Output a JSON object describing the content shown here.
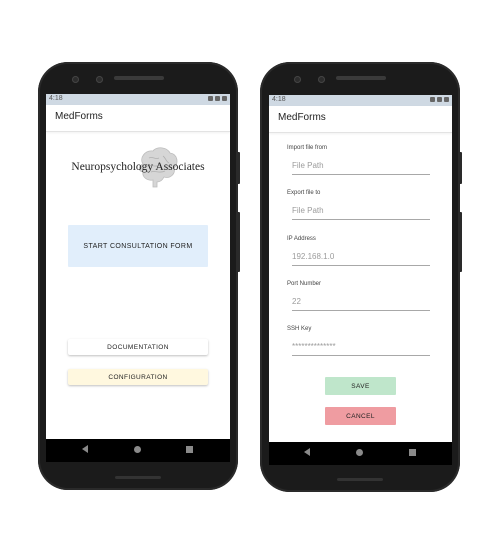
{
  "left_phone": {
    "status_time": "4:18",
    "app_title": "MedForms",
    "logo_text": "Neuropsychology Associates",
    "start_button": "START CONSULTATION FORM",
    "documentation_button": "DOCUMENTATION",
    "configuration_button": "CONFIGURATION"
  },
  "right_phone": {
    "status_time": "4:18",
    "app_title": "MedForms",
    "fields": [
      {
        "label": "Import file from",
        "placeholder": "File Path"
      },
      {
        "label": "Export file to",
        "placeholder": "File Path"
      },
      {
        "label": "IP Address",
        "placeholder": "192.168.1.0"
      },
      {
        "label": "Port Number",
        "placeholder": "22"
      },
      {
        "label": "SSH Key",
        "placeholder": "**************"
      }
    ],
    "save_button": "SAVE",
    "cancel_button": "CANCEL"
  },
  "colors": {
    "start_button_bg": "#e1eefb",
    "configuration_button_bg": "#fff8df",
    "save_button_bg": "#bfe6cb",
    "cancel_button_bg": "#ef9ca1",
    "status_bar_bg": "#cfd9e3"
  },
  "icons": [
    "brain-icon",
    "back-nav-icon",
    "home-nav-icon",
    "recents-nav-icon",
    "wifi-icon",
    "signal-icon",
    "battery-icon"
  ]
}
